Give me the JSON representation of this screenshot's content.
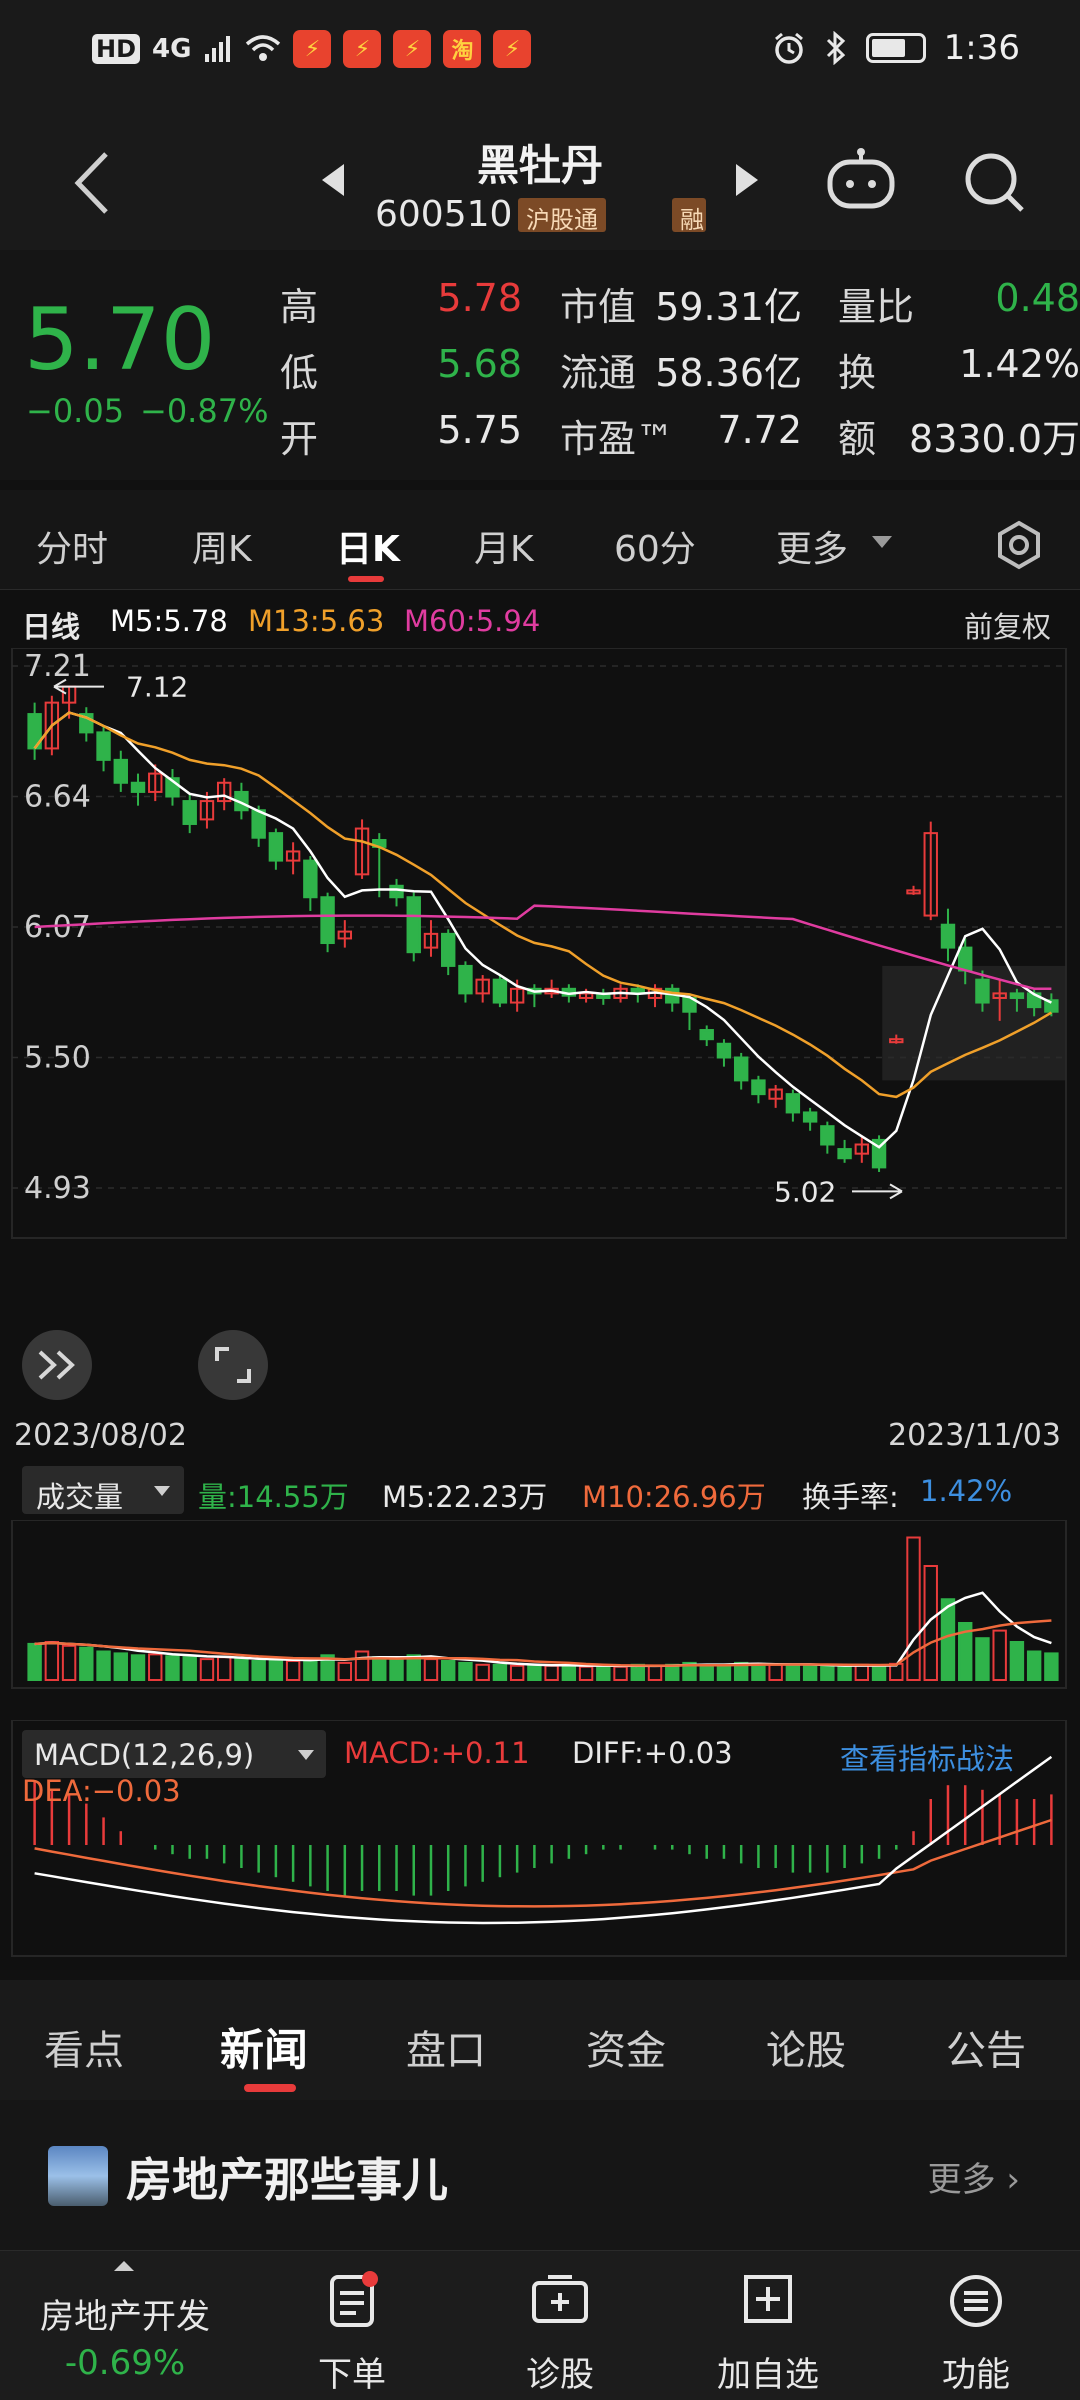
{
  "status_bar": {
    "left_badges": [
      "HD",
      "4G"
    ],
    "app_icons": [
      "⚡",
      "⚡",
      "⚡",
      "淘",
      "⚡"
    ],
    "time": "1:36",
    "battery_fraction": 0.7
  },
  "header": {
    "title": "黑牡丹",
    "code": "600510",
    "tag_1": "沪股通",
    "tag_2": "融"
  },
  "quote": {
    "price": "5.70",
    "change": "−0.05",
    "change_pct": "−0.87%",
    "high_label": "高",
    "high": "5.78",
    "low_label": "低",
    "low": "5.68",
    "open_label": "开",
    "open": "5.75",
    "mktcap_label": "市值",
    "mktcap": "59.31亿",
    "float_label": "流通",
    "float": "58.36亿",
    "pe_label": "市盈™",
    "pe": "7.72",
    "vol_ratio_label": "量比",
    "vol_ratio": "0.48",
    "turnover_label": "换",
    "turnover": "1.42%",
    "amount_label": "额",
    "amount": "8330.0万"
  },
  "kline_tabs": [
    "分时",
    "周K",
    "日K",
    "月K",
    "60分",
    "更多"
  ],
  "kline_active": "日K",
  "chart_legend": {
    "type": "日线",
    "m5": "M5:5.78",
    "m13": "M13:5.63",
    "m60": "M60:5.94",
    "adjust": "前复权",
    "y_ticks": [
      "7.21",
      "6.64",
      "6.07",
      "5.50",
      "4.93"
    ],
    "high_mark": "7.12",
    "low_mark": "5.02",
    "date_start": "2023/08/02",
    "date_end": "2023/11/03"
  },
  "volume_legend": {
    "title": "成交量",
    "vol": "量:14.55万",
    "m5": "M5:22.23万",
    "m10": "M10:26.96万",
    "turnover": "换手率:",
    "turnover_val": "1.42%"
  },
  "macd_legend": {
    "title": "MACD(12,26,9)",
    "macd": "MACD:+0.11",
    "diff": "DIFF:+0.03",
    "link": "查看指标战法",
    "dea": "DEA:−0.03"
  },
  "news_tabs": [
    "看点",
    "新闻",
    "盘口",
    "资金",
    "论股",
    "公告"
  ],
  "news_active": "新闻",
  "news_item": {
    "title": "房地产那些事儿",
    "more": "更多"
  },
  "bottom_bar": {
    "sector": "房地产开发",
    "sector_change": "-0.69%",
    "items": [
      "下单",
      "诊股",
      "加自选",
      "功能"
    ]
  },
  "colors": {
    "up": "#e83b3b",
    "down": "#2fb34a",
    "m5": "#ffffff",
    "m13": "#f0a02a",
    "m60": "#e03ca0",
    "link": "#3d8fe0"
  },
  "chart_data": {
    "type": "candlestick",
    "title": "",
    "y_ticks": [
      7.21,
      6.64,
      6.07,
      5.5,
      4.93
    ],
    "ylim": [
      4.93,
      7.21
    ],
    "x_range": [
      "2023/08/02",
      "2023/11/03"
    ],
    "candles": [
      [
        7.0,
        6.85,
        7.05,
        6.8
      ],
      [
        6.85,
        7.05,
        7.08,
        6.82
      ],
      [
        7.05,
        7.12,
        7.12,
        6.98
      ],
      [
        7.0,
        6.92,
        7.03,
        6.88
      ],
      [
        6.92,
        6.8,
        6.95,
        6.75
      ],
      [
        6.8,
        6.7,
        6.84,
        6.66
      ],
      [
        6.7,
        6.66,
        6.74,
        6.6
      ],
      [
        6.66,
        6.74,
        6.78,
        6.62
      ],
      [
        6.72,
        6.64,
        6.76,
        6.6
      ],
      [
        6.62,
        6.52,
        6.65,
        6.48
      ],
      [
        6.54,
        6.62,
        6.66,
        6.5
      ],
      [
        6.62,
        6.7,
        6.72,
        6.58
      ],
      [
        6.66,
        6.58,
        6.7,
        6.54
      ],
      [
        6.58,
        6.46,
        6.6,
        6.42
      ],
      [
        6.48,
        6.36,
        6.5,
        6.32
      ],
      [
        6.36,
        6.4,
        6.44,
        6.3
      ],
      [
        6.36,
        6.2,
        6.38,
        6.14
      ],
      [
        6.2,
        6.0,
        6.22,
        5.96
      ],
      [
        6.02,
        6.05,
        6.1,
        5.98
      ],
      [
        6.3,
        6.5,
        6.54,
        6.28
      ],
      [
        6.45,
        6.42,
        6.48,
        6.2
      ],
      [
        6.25,
        6.2,
        6.28,
        6.16
      ],
      [
        6.2,
        5.96,
        6.22,
        5.92
      ],
      [
        5.98,
        6.04,
        6.1,
        5.94
      ],
      [
        6.04,
        5.9,
        6.06,
        5.86
      ],
      [
        5.9,
        5.78,
        5.92,
        5.74
      ],
      [
        5.78,
        5.84,
        5.86,
        5.74
      ],
      [
        5.84,
        5.74,
        5.86,
        5.72
      ],
      [
        5.74,
        5.8,
        5.84,
        5.7
      ],
      [
        5.8,
        5.78,
        5.82,
        5.72
      ],
      [
        5.78,
        5.8,
        5.84,
        5.76
      ],
      [
        5.8,
        5.77,
        5.82,
        5.74
      ],
      [
        5.76,
        5.78,
        5.8,
        5.74
      ],
      [
        5.78,
        5.76,
        5.8,
        5.73
      ],
      [
        5.76,
        5.8,
        5.82,
        5.74
      ],
      [
        5.8,
        5.78,
        5.82,
        5.74
      ],
      [
        5.76,
        5.8,
        5.82,
        5.72
      ],
      [
        5.8,
        5.74,
        5.82,
        5.7
      ],
      [
        5.76,
        5.7,
        5.78,
        5.62
      ],
      [
        5.62,
        5.58,
        5.64,
        5.55
      ],
      [
        5.56,
        5.5,
        5.58,
        5.46
      ],
      [
        5.5,
        5.4,
        5.52,
        5.36
      ],
      [
        5.4,
        5.34,
        5.42,
        5.3
      ],
      [
        5.32,
        5.36,
        5.38,
        5.28
      ],
      [
        5.34,
        5.26,
        5.36,
        5.22
      ],
      [
        5.26,
        5.22,
        5.28,
        5.18
      ],
      [
        5.2,
        5.12,
        5.22,
        5.08
      ],
      [
        5.1,
        5.06,
        5.14,
        5.04
      ],
      [
        5.08,
        5.12,
        5.16,
        5.04
      ],
      [
        5.14,
        5.02,
        5.16,
        5.0
      ],
      [
        5.58,
        5.58,
        5.6,
        5.56
      ],
      [
        6.23,
        6.23,
        6.25,
        6.21
      ],
      [
        6.12,
        6.48,
        6.53,
        6.1
      ],
      [
        6.08,
        5.98,
        6.15,
        5.92
      ],
      [
        5.98,
        5.88,
        6.02,
        5.82
      ],
      [
        5.84,
        5.74,
        5.88,
        5.7
      ],
      [
        5.76,
        5.78,
        5.84,
        5.66
      ],
      [
        5.78,
        5.76,
        5.8,
        5.7
      ],
      [
        5.78,
        5.72,
        5.8,
        5.68
      ],
      [
        5.75,
        5.7,
        5.78,
        5.68
      ]
    ],
    "volume": [
      38,
      40,
      36,
      34,
      30,
      28,
      26,
      27,
      25,
      24,
      22,
      24,
      22,
      20,
      21,
      20,
      22,
      26,
      18,
      30,
      24,
      22,
      26,
      22,
      20,
      18,
      16,
      16,
      15,
      16,
      15,
      16,
      14,
      15,
      14,
      16,
      15,
      16,
      18,
      16,
      16,
      18,
      17,
      16,
      15,
      16,
      15,
      14,
      16,
      15,
      17,
      150,
      120,
      85,
      60,
      44,
      52,
      40,
      30,
      28
    ],
    "volume_ma5": [],
    "macd_hist": [
      0.14,
      0.12,
      0.11,
      0.09,
      0.06,
      0.03,
      0.0,
      -0.01,
      -0.02,
      -0.03,
      -0.03,
      -0.04,
      -0.05,
      -0.06,
      -0.07,
      -0.08,
      -0.09,
      -0.1,
      -0.11,
      -0.1,
      -0.1,
      -0.1,
      -0.11,
      -0.11,
      -0.1,
      -0.09,
      -0.08,
      -0.07,
      -0.06,
      -0.05,
      -0.04,
      -0.03,
      -0.02,
      -0.01,
      -0.01,
      0.0,
      -0.01,
      -0.01,
      -0.02,
      -0.03,
      -0.03,
      -0.04,
      -0.05,
      -0.05,
      -0.06,
      -0.06,
      -0.06,
      -0.05,
      -0.04,
      -0.03,
      -0.01,
      0.03,
      0.1,
      0.13,
      0.13,
      0.12,
      0.11,
      0.1,
      0.1,
      0.11
    ]
  }
}
